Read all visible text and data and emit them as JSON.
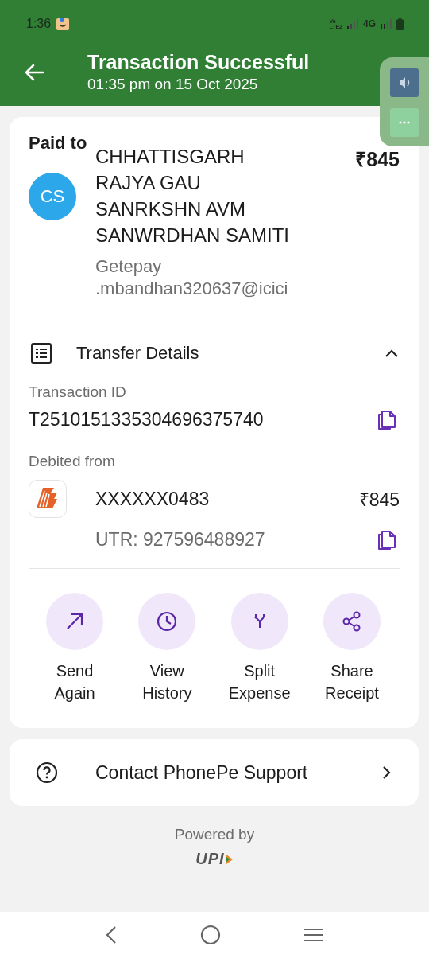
{
  "status_bar": {
    "time": "1:36",
    "network_top": "Vo",
    "network_bottom": "LTE2",
    "network_type": "4G"
  },
  "header": {
    "title": "Transaction Successful",
    "subtitle": "01:35 pm on 15 Oct 2025"
  },
  "payment": {
    "label": "Paid to",
    "avatar_initials": "CS",
    "payee_lines": [
      "CHHATTISGARH",
      "RAJYA GAU",
      "SANRKSHN AVM",
      "SANWRDHAN SAMITI"
    ],
    "upi_id_lines": [
      "Getepay",
      ".mbandhan320637@icici"
    ],
    "amount": "₹845"
  },
  "transfer_details": {
    "title": "Transfer Details",
    "expanded": true,
    "transaction_id_label": "Transaction ID",
    "transaction_id": "T2510151335304696375740",
    "debited_label": "Debited from",
    "account": "XXXXXX0483",
    "debited_amount": "₹845",
    "utr": "UTR: 927596488927"
  },
  "actions": [
    {
      "kind": "send",
      "lines": [
        "Send",
        "Again"
      ]
    },
    {
      "kind": "history",
      "lines": [
        "View",
        "History"
      ]
    },
    {
      "kind": "split",
      "lines": [
        "Split",
        "Expense"
      ]
    },
    {
      "kind": "share",
      "lines": [
        "Share",
        "Receipt"
      ]
    }
  ],
  "support": {
    "label": "Contact PhonePe Support"
  },
  "footer": {
    "powered_by": "Powered by",
    "logo_text": "UPI"
  }
}
